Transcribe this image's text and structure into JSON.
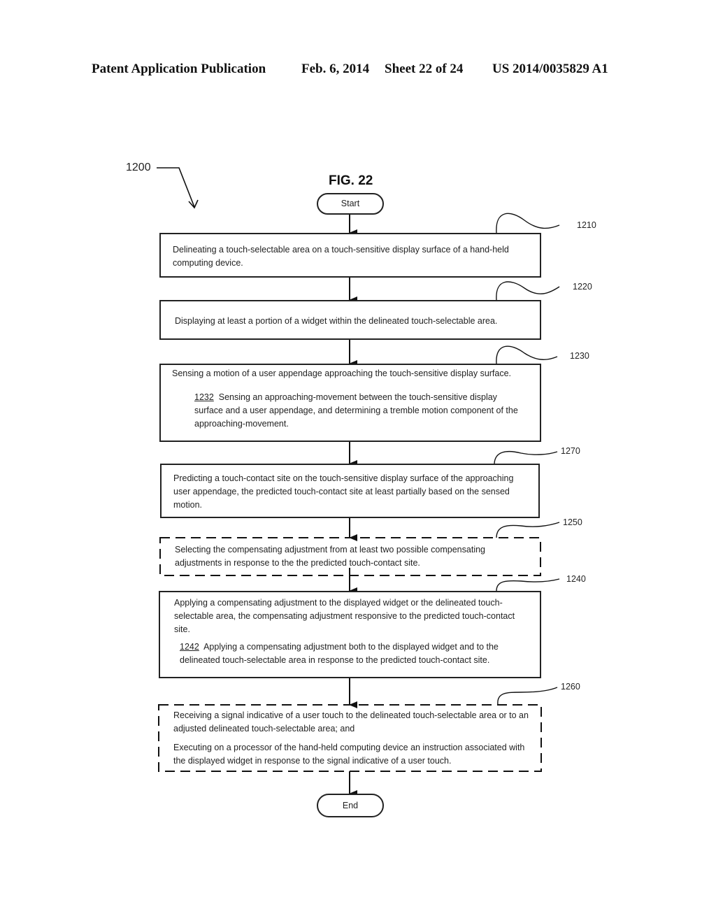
{
  "header": {
    "publication": "Patent Application Publication",
    "date": "Feb. 6, 2014",
    "sheet": "Sheet 22 of 24",
    "number": "US 2014/0035829 A1"
  },
  "figure": {
    "title": "FIG. 22",
    "ref": "1200"
  },
  "flow": {
    "start": "Start",
    "end": "End",
    "steps": [
      {
        "ref": "1210",
        "text": "Delineating a touch-selectable area on a touch-sensitive display surface of a hand-held computing device."
      },
      {
        "ref": "1220",
        "text": "Displaying at least a portion of a widget within the delineated touch-selectable area."
      },
      {
        "ref": "1230",
        "text": "Sensing a motion of a user appendage approaching the touch-sensitive display surface.",
        "sub": {
          "ref": "1232",
          "text": "Sensing an approaching-movement between the touch-sensitive display surface and a user appendage, and determining a tremble motion component of the approaching-movement."
        }
      },
      {
        "ref": "1270",
        "text": "Predicting a touch-contact site on the touch-sensitive display surface of the approaching user appendage, the predicted touch-contact site at least partially based on the sensed motion."
      },
      {
        "ref": "1250",
        "text": "Selecting the compensating adjustment from at least two possible compensating adjustments in response to the the predicted touch-contact site.",
        "optional": true
      },
      {
        "ref": "1240",
        "text": "Applying a compensating adjustment to the displayed widget or the delineated touch-selectable area, the compensating adjustment responsive to the predicted touch-contact site.",
        "sub": {
          "ref": "1242",
          "text": "Applying a compensating adjustment both to the displayed widget and to the delineated touch-selectable area in response to the predicted touch-contact site."
        }
      },
      {
        "ref": "1260",
        "text": "Receiving a signal indicative of a user touch to the delineated touch-selectable area or to an adjusted delineated touch-selectable area; and",
        "text2": "Executing on a processor of the hand-held computing device an instruction associated with the displayed widget in response to the signal indicative of a user touch.",
        "optional": true
      }
    ]
  }
}
